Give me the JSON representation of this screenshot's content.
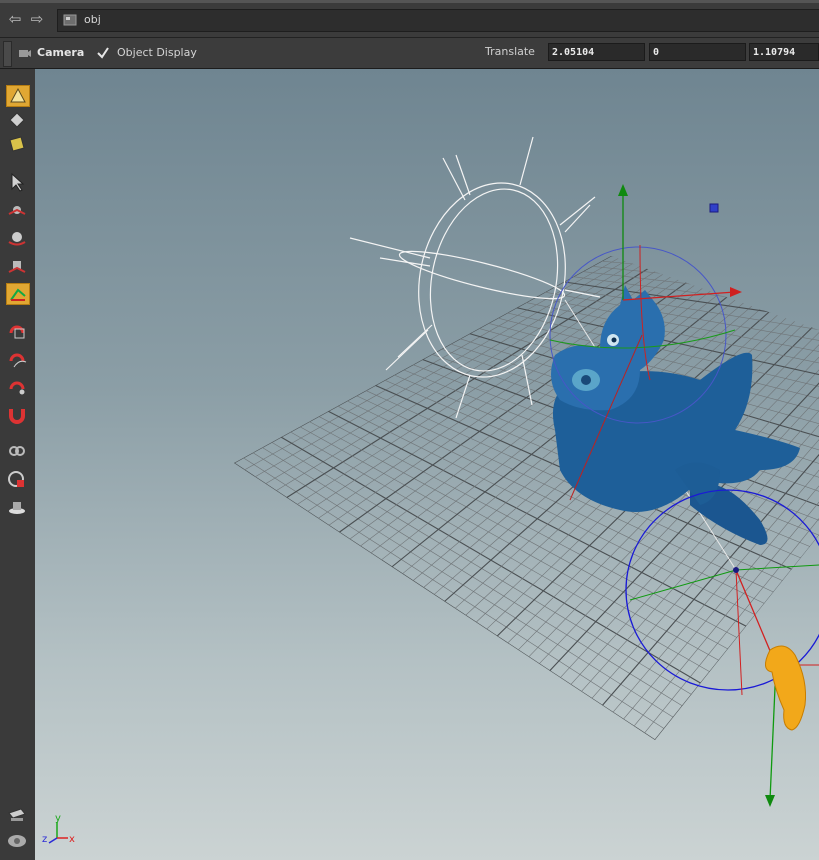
{
  "nav": {
    "back_icon": "back-arrow-icon",
    "forward_icon": "forward-arrow-icon"
  },
  "path": {
    "value": "obj"
  },
  "toolbar": {
    "camera_label": "Camera",
    "object_display_label": "Object Display",
    "translate_label": "Translate",
    "translate_x": "2.05104",
    "translate_y": "0",
    "translate_z": "1.10794"
  },
  "axes_gizmo": {
    "x": "x",
    "y": "y",
    "z": "z"
  },
  "tools": [
    {
      "name": "view-tool-icon",
      "selected": true
    },
    {
      "name": "select-diamond-icon",
      "selected": false
    },
    {
      "name": "select-box-icon",
      "selected": false
    },
    {
      "name": "select-arrow-icon",
      "selected": false
    },
    {
      "name": "move-tool-icon",
      "selected": false
    },
    {
      "name": "rotate-tool-icon",
      "selected": false
    },
    {
      "name": "scale-tool-icon",
      "selected": false
    },
    {
      "name": "handle-tool-icon",
      "selected": true
    },
    {
      "name": "snap-grid-icon",
      "selected": false
    },
    {
      "name": "snap-curve-icon",
      "selected": false
    },
    {
      "name": "snap-point-icon",
      "selected": false
    },
    {
      "name": "magnet-icon",
      "selected": false
    },
    {
      "name": "link-tool-icon",
      "selected": false
    },
    {
      "name": "render-region-icon",
      "selected": false
    },
    {
      "name": "lamp-icon",
      "selected": false
    },
    {
      "name": "display-options-icon",
      "selected": false
    },
    {
      "name": "camera-view-icon",
      "selected": false
    }
  ],
  "colors": {
    "accent": "#e0a733",
    "model": "#1e5f99",
    "light": "#f2a81a"
  }
}
